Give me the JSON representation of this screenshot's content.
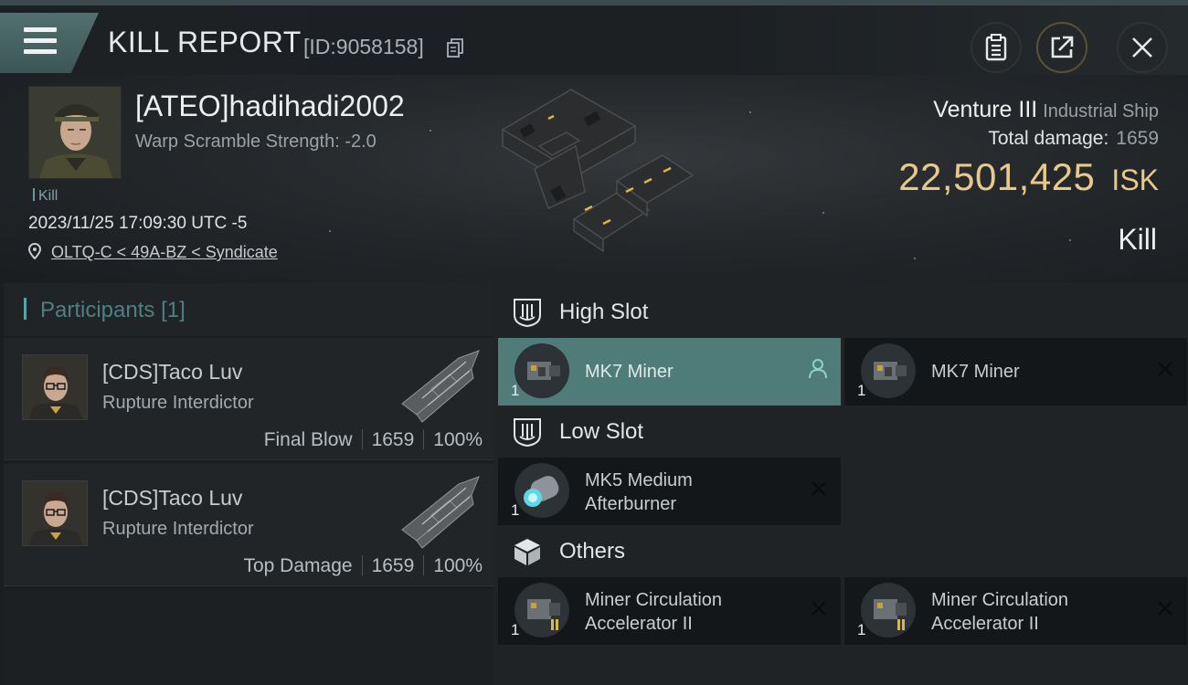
{
  "header": {
    "title": "KILL REPORT",
    "report_id": "[ID:9058158]",
    "icons": [
      "menu-icon",
      "copy-icon",
      "clipboard-icon",
      "share-icon",
      "close-icon"
    ]
  },
  "victim": {
    "name": "[ATEO]hadihadi2002",
    "warp_scramble": "Warp Scramble Strength: -2.0",
    "kill_tag": "Kill",
    "datetime": "2023/11/25 17:09:30 UTC -5",
    "location": "OLTQ-C < 49A-BZ < Syndicate"
  },
  "ship": {
    "name": "Venture III",
    "class": "Industrial Ship",
    "total_damage_label": "Total damage:",
    "total_damage": "1659",
    "isk_value": "22,501,425",
    "isk_unit": "ISK",
    "result": "Kill"
  },
  "participants": {
    "label": "Participants",
    "count": "[1]",
    "items": [
      {
        "name": "[CDS]Taco Luv",
        "ship": "Rupture Interdictor",
        "role": "Final Blow",
        "damage": "1659",
        "percent": "100%"
      },
      {
        "name": "[CDS]Taco Luv",
        "ship": "Rupture Interdictor",
        "role": "Top Damage",
        "damage": "1659",
        "percent": "100%"
      }
    ]
  },
  "slots": {
    "high": {
      "label": "High Slot",
      "items": [
        {
          "qty": "1",
          "name": "MK7 Miner"
        },
        {
          "qty": "1",
          "name": "MK7 Miner"
        }
      ]
    },
    "low": {
      "label": "Low Slot",
      "items": [
        {
          "qty": "1",
          "name_line1": "MK5 Medium",
          "name_line2": "Afterburner"
        }
      ]
    },
    "others": {
      "label": "Others",
      "items": [
        {
          "qty": "1",
          "name_line1": "Miner Circulation",
          "name_line2": "Accelerator II"
        },
        {
          "qty": "1",
          "name_line1": "Miner Circulation",
          "name_line2": "Accelerator II"
        }
      ]
    }
  },
  "colors": {
    "accent": "#57a3a6",
    "isk_gold": "#e7c98c",
    "active_slot": "#4f7c79",
    "menu_button": "#51706f"
  }
}
